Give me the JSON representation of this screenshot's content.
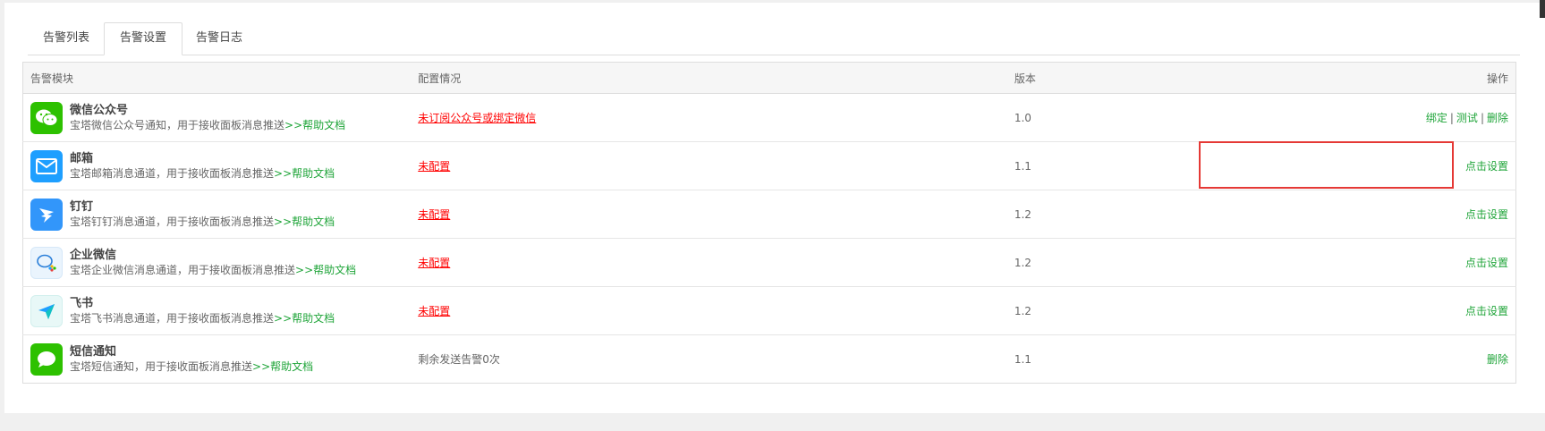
{
  "tabs": [
    {
      "label": "告警列表",
      "active": false
    },
    {
      "label": "告警设置",
      "active": true
    },
    {
      "label": "告警日志",
      "active": false
    }
  ],
  "table": {
    "headers": {
      "module": "告警模块",
      "config": "配置情况",
      "version": "版本",
      "actions": "操作"
    },
    "rows": [
      {
        "icon": "wechat-icon",
        "name": "微信公众号",
        "desc": "宝塔微信公众号通知，用于接收面板消息推送",
        "help": ">>帮助文档",
        "config": "未订阅公众号或绑定微信",
        "config_type": "link",
        "version": "1.0",
        "actions": [
          "绑定",
          "测试",
          "删除"
        ]
      },
      {
        "icon": "mail-icon",
        "name": "邮箱",
        "desc": "宝塔邮箱消息通道，用于接收面板消息推送",
        "help": ">>帮助文档",
        "config": "未配置",
        "config_type": "link",
        "version": "1.1",
        "actions": [
          "点击设置"
        ]
      },
      {
        "icon": "dingtalk-icon",
        "name": "钉钉",
        "desc": "宝塔钉钉消息通道，用于接收面板消息推送",
        "help": ">>帮助文档",
        "config": "未配置",
        "config_type": "link",
        "version": "1.2",
        "actions": [
          "点击设置"
        ]
      },
      {
        "icon": "wecom-icon",
        "name": "企业微信",
        "desc": "宝塔企业微信消息通道，用于接收面板消息推送",
        "help": ">>帮助文档",
        "config": "未配置",
        "config_type": "link",
        "version": "1.2",
        "actions": [
          "点击设置"
        ]
      },
      {
        "icon": "feishu-icon",
        "name": "飞书",
        "desc": "宝塔飞书消息通道，用于接收面板消息推送",
        "help": ">>帮助文档",
        "config": "未配置",
        "config_type": "link",
        "version": "1.2",
        "actions": [
          "点击设置"
        ]
      },
      {
        "icon": "sms-icon",
        "name": "短信通知",
        "desc": "宝塔短信通知，用于接收面板消息推送",
        "help": ">>帮助文档",
        "config": "剩余发送告警0次",
        "config_type": "text",
        "version": "1.1",
        "actions": [
          "删除"
        ]
      }
    ]
  },
  "colors": {
    "accent": "#20a53a",
    "warning": "#ff0000",
    "highlight": "#e53935"
  }
}
